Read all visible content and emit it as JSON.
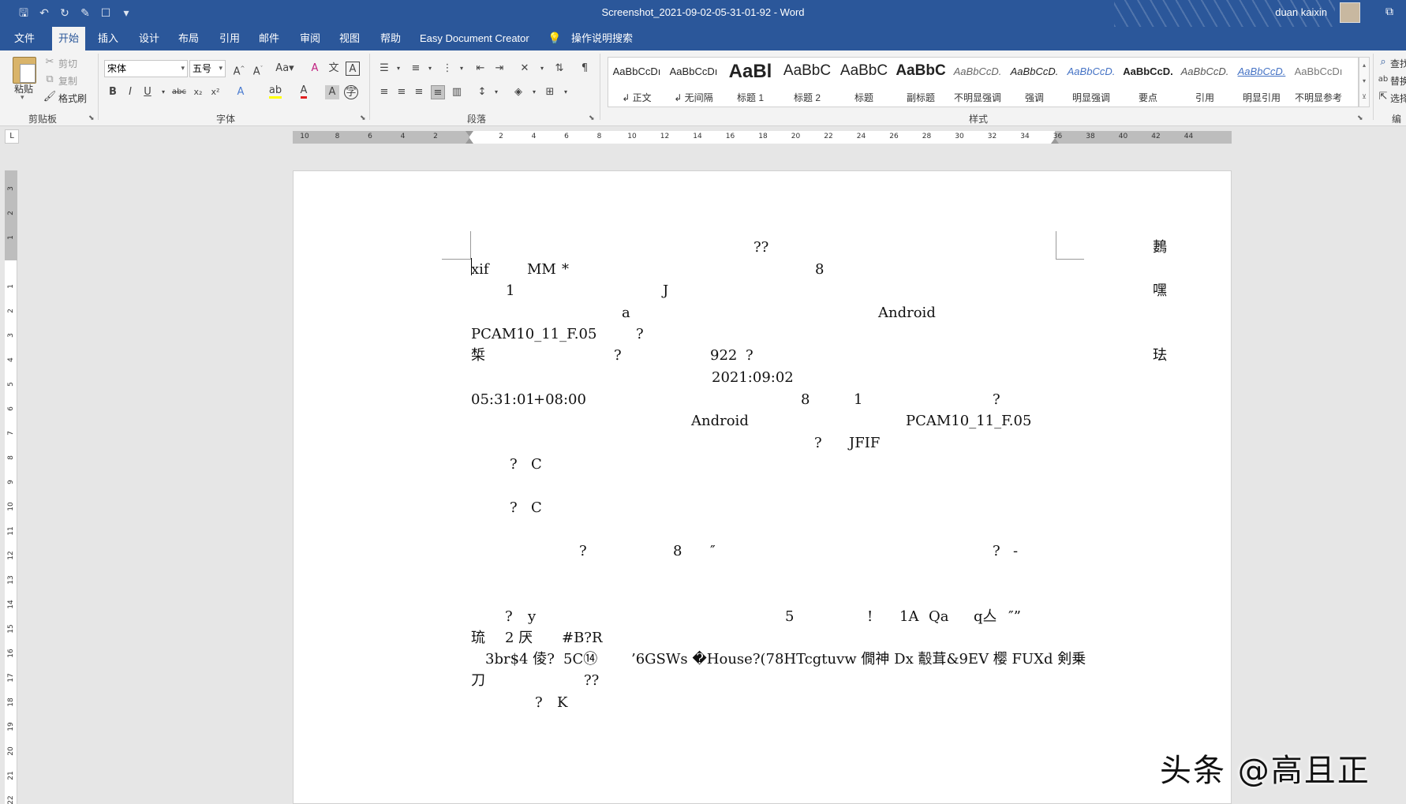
{
  "window": {
    "title": "Screenshot_2021-09-02-05-31-01-92 - Word",
    "user": "duan kaixin"
  },
  "tabs": [
    "文件",
    "开始",
    "插入",
    "设计",
    "布局",
    "引用",
    "邮件",
    "审阅",
    "视图",
    "帮助",
    "Easy Document Creator"
  ],
  "active_tab": "开始",
  "tell_me": "操作说明搜索",
  "clipboard": {
    "paste": "粘贴",
    "cut": "剪切",
    "copy": "复制",
    "format_painter": "格式刷",
    "group": "剪贴板"
  },
  "font": {
    "name": "宋体",
    "size": "五号",
    "group": "字体"
  },
  "paragraph": {
    "group": "段落"
  },
  "styles": {
    "group": "样式",
    "items": [
      {
        "preview": "AaBbCcDı",
        "name": "↲ 正文"
      },
      {
        "preview": "AaBbCcDı",
        "name": "↲ 无间隔"
      },
      {
        "preview": "AaBl",
        "name": "标题 1"
      },
      {
        "preview": "AaBbC",
        "name": "标题 2"
      },
      {
        "preview": "AaBbC",
        "name": "标题"
      },
      {
        "preview": "AaBbC",
        "name": "副标题"
      },
      {
        "preview": "AaBbCcD.",
        "name": "不明显强调"
      },
      {
        "preview": "AaBbCcD.",
        "name": "强调"
      },
      {
        "preview": "AaBbCcD.",
        "name": "明显强调"
      },
      {
        "preview": "AaBbCcD.",
        "name": "要点"
      },
      {
        "preview": "AaBbCcD.",
        "name": "引用"
      },
      {
        "preview": "AaBbCcD.",
        "name": "明显引用"
      },
      {
        "preview": "AaBbCcDı",
        "name": "不明显参考"
      }
    ]
  },
  "editing": {
    "find": "查找",
    "replace": "替换",
    "select": "选择",
    "group": "编辑"
  },
  "ruler": {
    "ticks": [
      "10",
      "8",
      "6",
      "4",
      "2",
      "",
      "2",
      "4",
      "6",
      "8",
      "10",
      "12",
      "14",
      "16",
      "18",
      "20",
      "22",
      "24",
      "26",
      "28",
      "30",
      "32",
      "34",
      "36",
      "38",
      "40",
      "42",
      "44"
    ],
    "vticks": [
      "3",
      "2",
      "1",
      "",
      "1",
      "2",
      "3",
      "4",
      "5",
      "6",
      "7",
      "8",
      "9",
      "10",
      "11",
      "12",
      "13",
      "14",
      "15",
      "16",
      "17",
      "18",
      "19",
      "20",
      "21",
      "22"
    ]
  },
  "document": {
    "lines": [
      {
        "segments": [
          {
            "text": "??"
          },
          {
            "text": "鶈"
          }
        ]
      },
      {
        "segments": [
          {
            "text": "xif"
          },
          {
            "text": "MM"
          },
          {
            "text": "*"
          },
          {
            "text": "8"
          }
        ]
      },
      {
        "segments": [
          {
            "text": "1"
          },
          {
            "text": "J"
          },
          {
            "text": "嘿"
          }
        ]
      },
      {
        "segments": [
          {
            "text": "a"
          },
          {
            "text": "Android"
          }
        ]
      },
      {
        "segments": [
          {
            "text": "PCAM10_11_F.05"
          },
          {
            "text": "?"
          }
        ]
      },
      {
        "segments": [
          {
            "text": "椞"
          },
          {
            "text": "?"
          },
          {
            "text": "922"
          },
          {
            "text": "?"
          },
          {
            "text": "珐"
          }
        ]
      },
      {
        "segments": [
          {
            "text": "2021:09:02"
          }
        ]
      },
      {
        "segments": [
          {
            "text": "05:31:01"
          },
          {
            "text": "+08:00"
          },
          {
            "text": "8"
          },
          {
            "text": "1"
          },
          {
            "text": "?"
          }
        ]
      },
      {
        "segments": [
          {
            "text": "Android"
          },
          {
            "text": "PCAM10_11_F.05"
          }
        ]
      },
      {
        "segments": [
          {
            "text": "?"
          },
          {
            "text": "JFIF"
          }
        ]
      },
      {
        "segments": [
          {
            "text": "?"
          },
          {
            "text": "C"
          }
        ]
      },
      {
        "segments": [
          {
            "text": "?"
          },
          {
            "text": "C"
          }
        ]
      },
      {
        "segments": [
          {
            "text": "?"
          },
          {
            "text": "8"
          },
          {
            "text": "″"
          },
          {
            "text": "?"
          },
          {
            "text": "-"
          }
        ]
      },
      {
        "segments": [
          {
            "text": "?"
          },
          {
            "text": "y"
          },
          {
            "text": "5"
          },
          {
            "text": "!"
          },
          {
            "text": "1A"
          },
          {
            "text": "Qa"
          },
          {
            "text": "q亼"
          },
          {
            "text": "″”"
          }
        ]
      },
      {
        "segments": [
          {
            "text": "琉"
          },
          {
            "text": "2 厌"
          },
          {
            "text": "#B?R"
          }
        ]
      },
      {
        "segments": [
          {
            "text": "3br$4 倰?"
          },
          {
            "text": "5C⑭"
          },
          {
            "text": "’6GSWs �House?(78HTcgtuvw 僩神 Dx 鷇茸&9EV 樱 FUXd 剣乗"
          }
        ]
      },
      {
        "segments": [
          {
            "text": "刀"
          },
          {
            "text": "??"
          }
        ]
      },
      {
        "segments": [
          {
            "text": "?"
          },
          {
            "text": "K"
          }
        ]
      }
    ]
  },
  "watermark": "头条 @高且正"
}
